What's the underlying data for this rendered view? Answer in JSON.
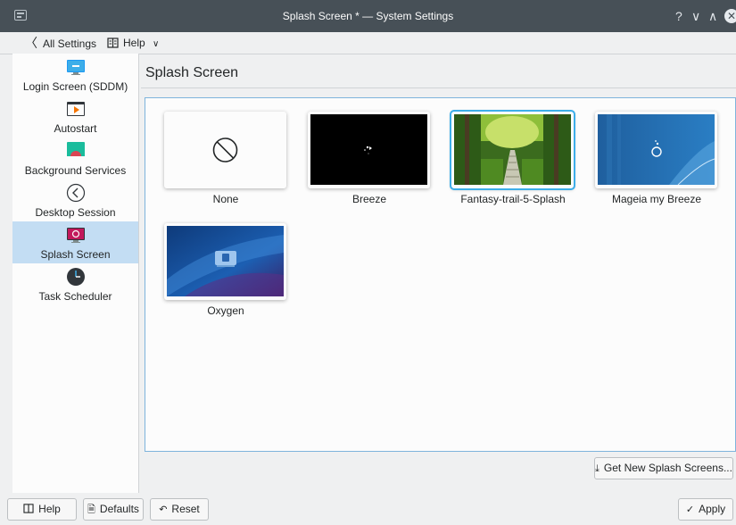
{
  "window": {
    "title": "Splash Screen * — System Settings",
    "controls": {
      "help": "?",
      "minimize": "∨",
      "maximize": "∧",
      "close": "✕"
    }
  },
  "toolbar": {
    "back_label": "All Settings",
    "help_label": "Help"
  },
  "sidebar": {
    "items": [
      {
        "label": "Login Screen (SDDM)",
        "icon": "monitor-login-icon"
      },
      {
        "label": "Autostart",
        "icon": "autostart-icon"
      },
      {
        "label": "Background Services",
        "icon": "background-services-icon"
      },
      {
        "label": "Desktop Session",
        "icon": "desktop-session-icon"
      },
      {
        "label": "Splash Screen",
        "icon": "splash-screen-icon",
        "selected": true
      },
      {
        "label": "Task Scheduler",
        "icon": "clock-icon"
      }
    ]
  },
  "main": {
    "heading": "Splash Screen",
    "themes": [
      {
        "label": "None",
        "preview": "none-icon"
      },
      {
        "label": "Breeze",
        "preview": "breeze-preview"
      },
      {
        "label": "Fantasy-trail-5-Splash",
        "preview": "forest-preview",
        "selected": true
      },
      {
        "label": "Mageia my Breeze",
        "preview": "mageia-preview"
      },
      {
        "label": "Oxygen",
        "preview": "oxygen-preview"
      }
    ],
    "get_new_label": "Get New Splash Screens..."
  },
  "footer": {
    "help_label": "Help",
    "defaults_label": "Defaults",
    "reset_label": "Reset",
    "apply_label": "Apply"
  },
  "colors": {
    "titlebar": "#475057",
    "selection": "#c3ddf3",
    "accent": "#3daee9",
    "background": "#eff0f1"
  }
}
